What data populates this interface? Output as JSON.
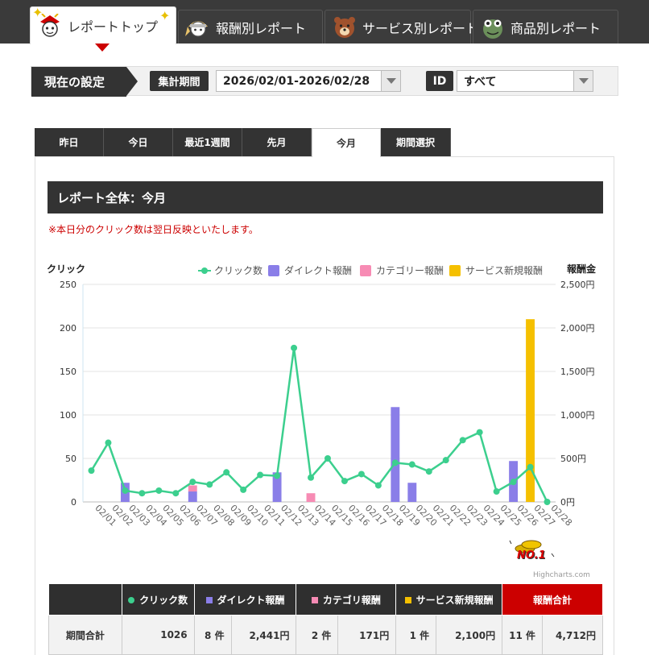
{
  "top_tabs": [
    {
      "label": "レポートトップ",
      "icon": "samurai-mascot-icon",
      "active": true
    },
    {
      "label": "報酬別レポート",
      "icon": "ninja-mascot-icon",
      "active": false
    },
    {
      "label": "サービス別レポート",
      "icon": "bear-mascot-icon",
      "active": false
    },
    {
      "label": "商品別レポート",
      "icon": "frog-mascot-icon",
      "active": false
    }
  ],
  "settings": {
    "title": "現在の設定",
    "period_label": "集計期間",
    "period_value": "2026/02/01-2026/02/28",
    "id_label": "ID",
    "id_value": "すべて"
  },
  "period_tabs": [
    {
      "label": "昨日",
      "active": false
    },
    {
      "label": "今日",
      "active": false
    },
    {
      "label": "最近1週間",
      "active": false
    },
    {
      "label": "先月",
      "active": false
    },
    {
      "label": "今月",
      "active": true
    },
    {
      "label": "期間選択",
      "active": false
    }
  ],
  "report": {
    "title": "レポート全体：今月",
    "note": "※本日分のクリック数は翌日反映といたします。"
  },
  "chart_data": {
    "type": "bar",
    "left_axis_title": "クリック",
    "right_axis_title": "報酬金",
    "left_ylim": [
      0,
      250
    ],
    "left_ticks": [
      "0",
      "50",
      "100",
      "150",
      "200",
      "250"
    ],
    "right_ylim": [
      0,
      2500
    ],
    "right_ticks": [
      "0円",
      "500円",
      "1,000円",
      "1,500円",
      "2,000円",
      "2,500円"
    ],
    "legend_position": "top",
    "grid": true,
    "categories": [
      "02/01",
      "02/02",
      "02/03",
      "02/04",
      "02/05",
      "02/06",
      "02/07",
      "02/08",
      "02/09",
      "02/10",
      "02/11",
      "02/12",
      "02/13",
      "02/14",
      "02/15",
      "02/16",
      "02/17",
      "02/18",
      "02/19",
      "02/20",
      "02/21",
      "02/22",
      "02/23",
      "02/24",
      "02/25",
      "02/26",
      "02/27",
      "02/28"
    ],
    "series": [
      {
        "name": "クリック数",
        "kind": "line",
        "axis": "left",
        "color": "#3ccf8e",
        "values": [
          36,
          68,
          13,
          10,
          13,
          10,
          23,
          20,
          34,
          14,
          31,
          30,
          177,
          28,
          50,
          24,
          32,
          19,
          45,
          43,
          35,
          48,
          71,
          80,
          12,
          23,
          40,
          0
        ]
      },
      {
        "name": "ダイレクト報酬",
        "kind": "column",
        "axis": "right",
        "color": "#8a7ee8",
        "values": [
          0,
          0,
          220,
          0,
          0,
          0,
          120,
          0,
          0,
          0,
          0,
          340,
          0,
          0,
          0,
          0,
          0,
          0,
          1090,
          220,
          0,
          0,
          0,
          0,
          0,
          470,
          0,
          0
        ]
      },
      {
        "name": "カテゴリー報酬",
        "kind": "column",
        "axis": "right",
        "color": "#f78bb4",
        "values": [
          0,
          0,
          0,
          0,
          0,
          0,
          70,
          0,
          0,
          0,
          0,
          0,
          0,
          100,
          0,
          0,
          0,
          0,
          0,
          0,
          0,
          0,
          0,
          0,
          0,
          0,
          0,
          0
        ]
      },
      {
        "name": "サービス新規報酬",
        "kind": "column",
        "axis": "right",
        "color": "#f5c000",
        "values": [
          0,
          0,
          0,
          0,
          0,
          0,
          0,
          0,
          0,
          0,
          0,
          0,
          0,
          0,
          0,
          0,
          0,
          0,
          0,
          0,
          0,
          0,
          0,
          0,
          0,
          0,
          2100,
          0
        ]
      }
    ]
  },
  "badge_text": "NO.1",
  "credit": "Highcharts.com",
  "summary": {
    "headers": {
      "click": "クリック数",
      "direct": "ダイレクト報酬",
      "category": "カテゴリ報酬",
      "service": "サービス新規報酬",
      "total": "報酬合計"
    },
    "colors": {
      "click": "#3ccf8e",
      "direct": "#8a7ee8",
      "category": "#f78bb4",
      "service": "#f5c000"
    },
    "row": {
      "label": "期間合計",
      "clicks": "1026",
      "direct_count": "8 件",
      "direct_amount": "2,441円",
      "category_count": "2 件",
      "category_amount": "171円",
      "service_count": "1 件",
      "service_amount": "2,100円",
      "total_count": "11 件",
      "total_amount": "4,712円"
    }
  }
}
